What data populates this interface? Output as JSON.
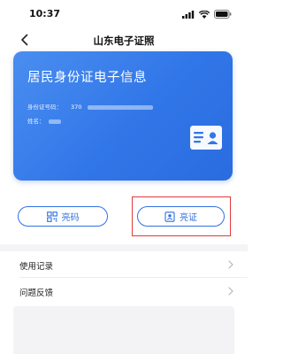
{
  "status_bar": {
    "time": "10:37"
  },
  "nav": {
    "title": "山东电子证照"
  },
  "card": {
    "title": "居民身份证电子信息",
    "id_label": "身份证号码：",
    "id_value_prefix": "370",
    "name_label": "姓名：",
    "accent_color": "#3176e8"
  },
  "buttons": {
    "qr_label": "亮码",
    "cert_label": "亮证"
  },
  "list": {
    "items": [
      {
        "label": "使用记录"
      },
      {
        "label": "问题反馈"
      }
    ]
  },
  "icons": {
    "back": "chevron-left-icon",
    "signal": "signal-icon",
    "wifi": "wifi-icon",
    "battery": "battery-icon",
    "card": "id-card-icon",
    "qr": "qr-code-icon",
    "cert": "id-badge-icon",
    "arrow": "chevron-right-icon"
  },
  "highlight_color": "#e23a3a"
}
